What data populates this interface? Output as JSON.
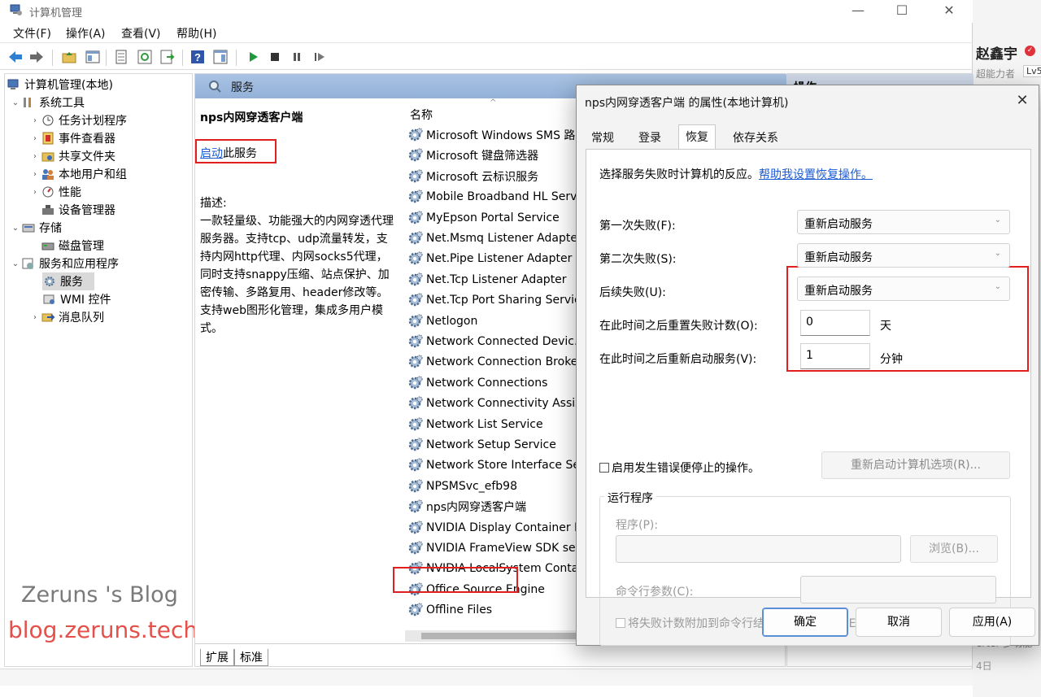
{
  "window": {
    "title": "计算机管理",
    "menu": [
      "文件(F)",
      "操作(A)",
      "查看(V)",
      "帮助(H)"
    ]
  },
  "tree": {
    "items": [
      {
        "label": "计算机管理(本地)",
        "level": 0,
        "expander": "",
        "icon": "computer-icon"
      },
      {
        "label": "系统工具",
        "level": 1,
        "expander": "v",
        "icon": "tools-icon"
      },
      {
        "label": "任务计划程序",
        "level": 2,
        "expander": ">",
        "icon": "clock-icon"
      },
      {
        "label": "事件查看器",
        "level": 2,
        "expander": ">",
        "icon": "event-viewer-icon"
      },
      {
        "label": "共享文件夹",
        "level": 2,
        "expander": ">",
        "icon": "shared-folder-icon"
      },
      {
        "label": "本地用户和组",
        "level": 2,
        "expander": ">",
        "icon": "users-icon"
      },
      {
        "label": "性能",
        "level": 2,
        "expander": ">",
        "icon": "performance-icon"
      },
      {
        "label": "设备管理器",
        "level": 2,
        "expander": "",
        "icon": "device-manager-icon"
      },
      {
        "label": "存储",
        "level": 1,
        "expander": "v",
        "icon": "storage-icon"
      },
      {
        "label": "磁盘管理",
        "level": 2,
        "expander": "",
        "icon": "disk-icon"
      },
      {
        "label": "服务和应用程序",
        "level": 1,
        "expander": "v",
        "icon": "services-apps-icon"
      },
      {
        "label": "服务",
        "level": 2,
        "expander": "",
        "icon": "gear-icon",
        "selected": true
      },
      {
        "label": "WMI 控件",
        "level": 2,
        "expander": "",
        "icon": "wmi-icon"
      },
      {
        "label": "消息队列",
        "level": 2,
        "expander": ">",
        "icon": "message-queue-icon"
      }
    ]
  },
  "watermark": {
    "line1": "Zeruns 's Blog",
    "line2": "blog.zeruns.tech"
  },
  "center": {
    "header": "服务",
    "service_title": "nps内网穿透客户端",
    "start_link": "启动",
    "start_suffix": "此服务",
    "desc_label": "描述:",
    "description": "一款轻量级、功能强大的内网穿透代理服务器。支持tcp、udp流量转发，支持内网http代理、内网socks5代理，同时支持snappy压缩、站点保护、加密传输、多路复用、header修改等。支持web图形化管理，集成多用户模式。",
    "column_name": "名称",
    "sort_arrow": "^",
    "services": [
      "Microsoft Windows SMS 路...",
      "Microsoft 键盘筛选器",
      "Microsoft 云标识服务",
      "Mobile Broadband HL Servi...",
      "MyEpson Portal Service",
      "Net.Msmq Listener Adapter",
      "Net.Pipe Listener Adapter",
      "Net.Tcp Listener Adapter",
      "Net.Tcp Port Sharing Service",
      "Netlogon",
      "Network Connected Devic...",
      "Network Connection Broker",
      "Network Connections",
      "Network Connectivity Assis...",
      "Network List Service",
      "Network Setup Service",
      "Network Store Interface Se...",
      "NPSMSvc_efb98",
      "nps内网穿透客户端",
      "NVIDIA Display Container LS",
      "NVIDIA FrameView SDK se...",
      "NVIDIA LocalSystem Conta...",
      "Office  Source Engine",
      "Offline Files"
    ],
    "bottom_tabs": [
      "扩展",
      "标准"
    ]
  },
  "actions": {
    "header": "操作"
  },
  "background": {
    "name": "赵鑫宇",
    "subtitle": "超能力者",
    "level": "Lv5",
    "right_text1": "erter 多功能",
    "right_text2": "4日"
  },
  "dialog": {
    "title": "nps内网穿透客户端 的属性(本地计算机)",
    "tabs": [
      "常规",
      "登录",
      "恢复",
      "依存关系"
    ],
    "active_tab": "恢复",
    "description": "选择服务失败时计算机的反应。",
    "help_link": "帮助我设置恢复操作。",
    "first_failure_label": "第一次失败(F):",
    "first_failure_value": "重新启动服务",
    "second_failure_label": "第二次失败(S):",
    "second_failure_value": "重新启动服务",
    "subsequent_label": "后续失败(U):",
    "subsequent_value": "重新启动服务",
    "reset_label": "在此时间之后重置失败计数(O):",
    "reset_value": "0",
    "reset_unit": "天",
    "restart_label": "在此时间之后重新启动服务(V):",
    "restart_value": "1",
    "restart_unit": "分钟",
    "enable_actions_label": "启用发生错误便停止的操作。",
    "restart_computer_button": "重新启动计算机选项(R)...",
    "run_program_group": "运行程序",
    "program_label": "程序(P):",
    "browse_button": "浏览(B)...",
    "cmd_args_label": "命令行参数(C):",
    "append_fail_label": "将失败计数附加到命令行结尾(/fail=%1%)(E)",
    "ok_button": "确定",
    "cancel_button": "取消",
    "apply_button": "应用(A)"
  }
}
